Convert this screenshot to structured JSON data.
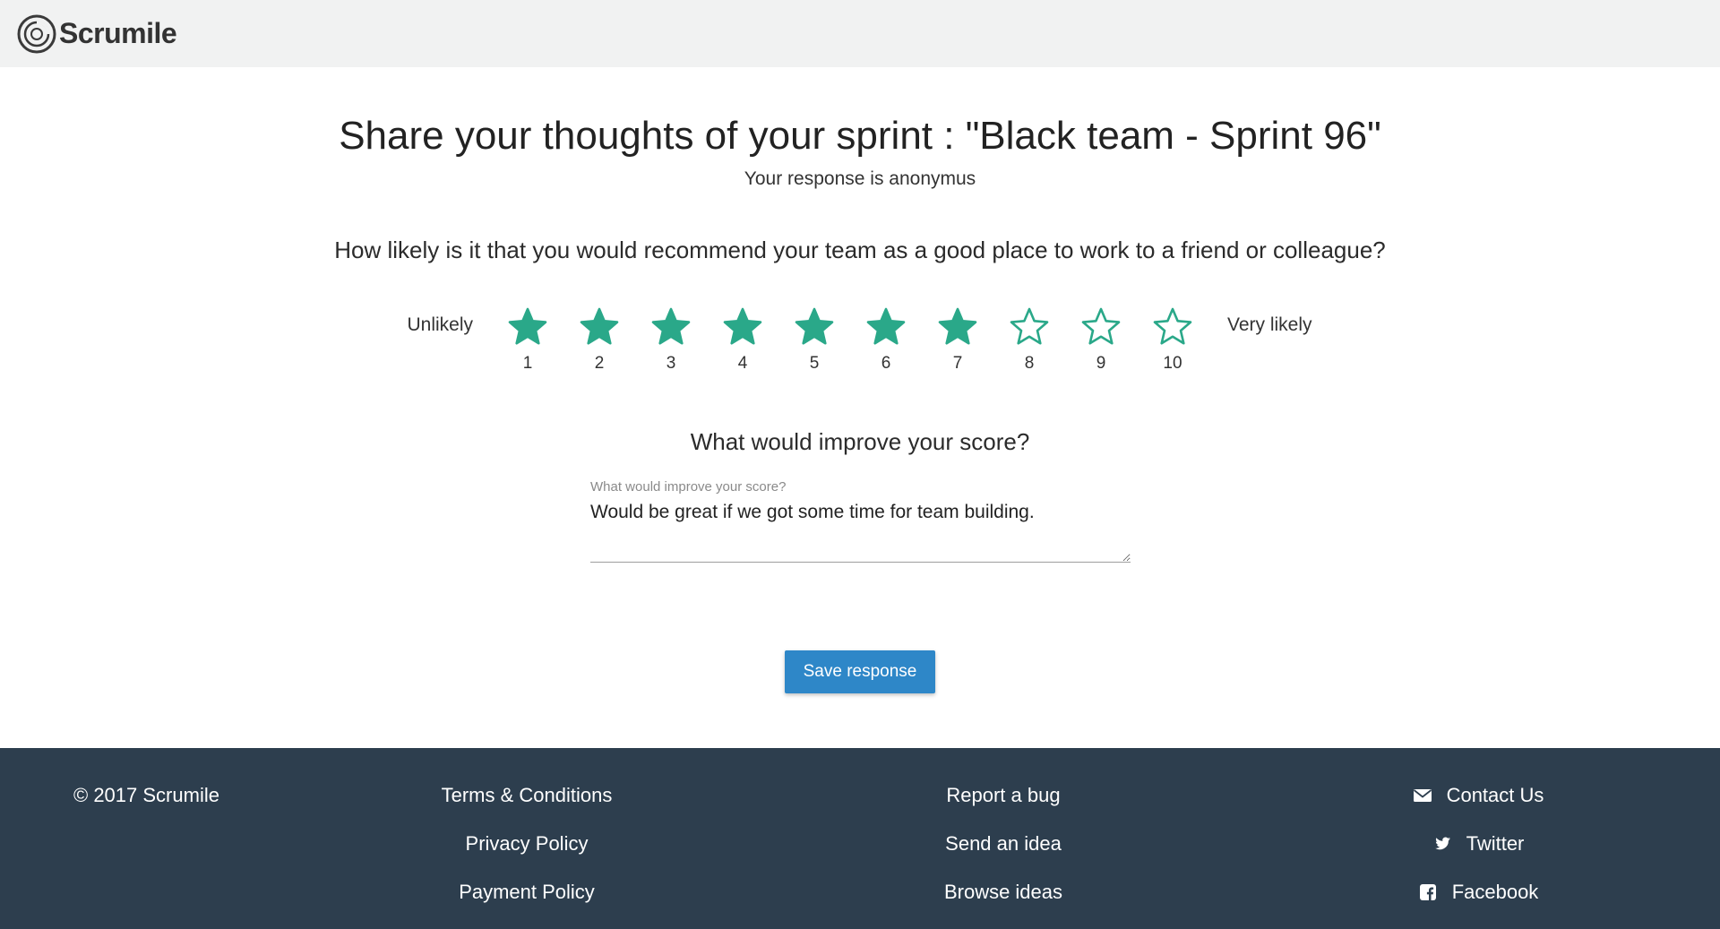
{
  "header": {
    "brand": "Scrumile",
    "logo_icon": "scrumile-logo-icon"
  },
  "survey": {
    "title": "Share your thoughts of your sprint : \"Black team - Sprint 96\"",
    "subtitle": "Your response is anonymus",
    "question": "How likely is it that you would recommend your team as a good place to work to a friend or colleague?",
    "scale_low_label": "Unlikely",
    "scale_high_label": "Very likely",
    "rating_value": 7,
    "rating_max": 10,
    "stars": [
      {
        "label": "1",
        "filled": true
      },
      {
        "label": "2",
        "filled": true
      },
      {
        "label": "3",
        "filled": true
      },
      {
        "label": "4",
        "filled": true
      },
      {
        "label": "5",
        "filled": true
      },
      {
        "label": "6",
        "filled": true
      },
      {
        "label": "7",
        "filled": true
      },
      {
        "label": "8",
        "filled": false
      },
      {
        "label": "9",
        "filled": false
      },
      {
        "label": "10",
        "filled": false
      }
    ],
    "improve_question": "What would improve your score?",
    "improve_field": {
      "label": "What would improve your score?",
      "value": "Would be great if we got some time for team building."
    },
    "save_label": "Save response",
    "accent_color": "#2aa889",
    "button_color": "#2e87c8"
  },
  "footer": {
    "copyright": "© 2017 Scrumile",
    "legal_links": [
      "Terms & Conditions",
      "Privacy Policy",
      "Payment Policy"
    ],
    "feedback_links": [
      "Report a bug",
      "Send an idea",
      "Browse ideas"
    ],
    "contact_links": [
      {
        "label": "Contact Us",
        "icon": "envelope-icon"
      },
      {
        "label": "Twitter",
        "icon": "twitter-icon"
      },
      {
        "label": "Facebook",
        "icon": "facebook-icon"
      }
    ],
    "background_color": "#2d3e4e"
  }
}
